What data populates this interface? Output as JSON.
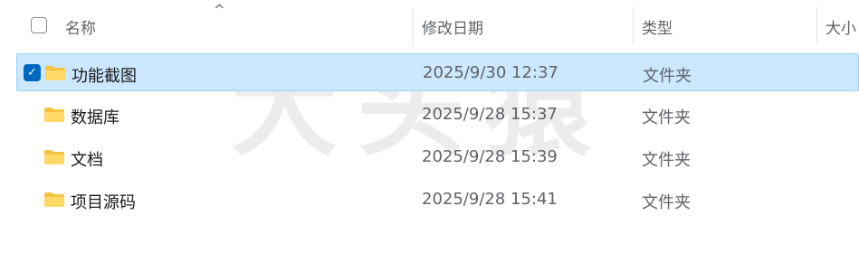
{
  "header": {
    "columns": {
      "name": "名称",
      "modified": "修改日期",
      "type": "类型",
      "size": "大小"
    },
    "sort_arrow": "^"
  },
  "rows": [
    {
      "name": "功能截图",
      "modified": "2025/9/30 12:37",
      "type": "文件夹",
      "selected": true,
      "check_glyph": "✓"
    },
    {
      "name": "数据库",
      "modified": "2025/9/28 15:37",
      "type": "文件夹",
      "selected": false
    },
    {
      "name": "文档",
      "modified": "2025/9/28 15:39",
      "type": "文件夹",
      "selected": false
    },
    {
      "name": "项目源码",
      "modified": "2025/9/28 15:41",
      "type": "文件夹",
      "selected": false
    }
  ],
  "watermark": "大头猿",
  "colors": {
    "selection_bg": "#cce8ff",
    "selection_border": "#99d1ff",
    "checkbox_accent": "#0067c0",
    "folder": "#f6c343"
  },
  "icons": {
    "folder": "folder-icon",
    "checkbox": "checkbox-icon",
    "sort": "sort-ascending-icon"
  }
}
